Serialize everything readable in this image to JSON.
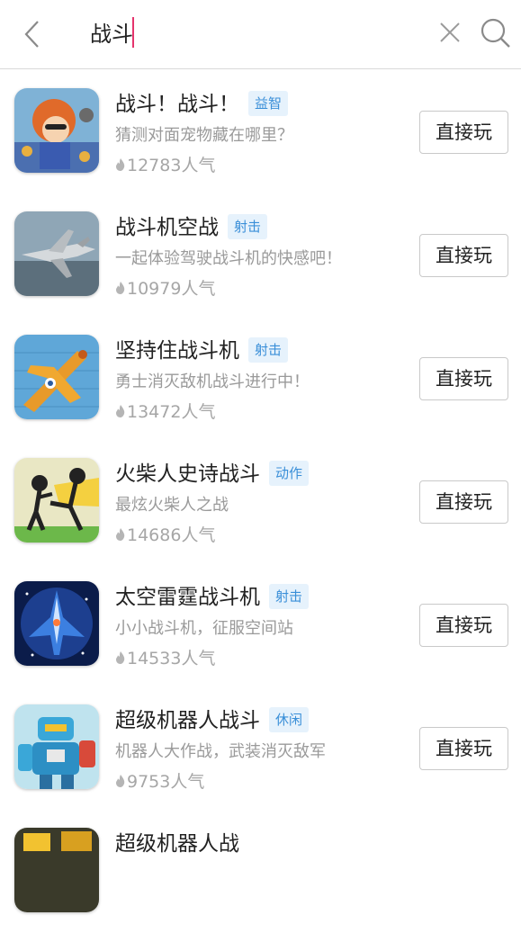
{
  "search": {
    "query": "战斗"
  },
  "items": [
    {
      "title": "战斗！战斗！",
      "tag": "益智",
      "desc": "猜测对面宠物藏在哪里？",
      "popularity": "12783人气",
      "button": "直接玩",
      "icon": "cartoon-girl-icon"
    },
    {
      "title": "战斗机空战",
      "tag": "射击",
      "desc": "一起体验驾驶战斗机的快感吧！",
      "popularity": "10979人气",
      "button": "直接玩",
      "icon": "fighter-jet-icon"
    },
    {
      "title": "坚持住战斗机",
      "tag": "射击",
      "desc": "勇士消灭敌机战斗进行中！",
      "popularity": "13472人气",
      "button": "直接玩",
      "icon": "orange-plane-icon"
    },
    {
      "title": "火柴人史诗战斗",
      "tag": "动作",
      "desc": "最炫火柴人之战",
      "popularity": "14686人气",
      "button": "直接玩",
      "icon": "stickman-fight-icon"
    },
    {
      "title": "太空雷霆战斗机",
      "tag": "射击",
      "desc": "小小战斗机，征服空间站",
      "popularity": "14533人气",
      "button": "直接玩",
      "icon": "space-fighter-icon"
    },
    {
      "title": "超级机器人战斗",
      "tag": "休闲",
      "desc": "机器人大作战，武装消灭敌军",
      "popularity": "9753人气",
      "button": "直接玩",
      "icon": "robot-icon"
    },
    {
      "title": "超级机器人战",
      "tag": "",
      "desc": "",
      "popularity": "",
      "button": "",
      "icon": "robot-icon"
    }
  ]
}
